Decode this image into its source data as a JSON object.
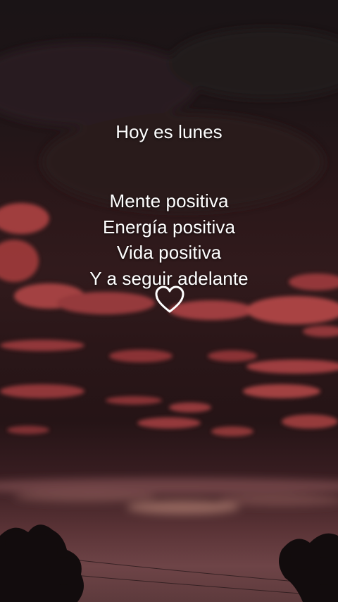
{
  "caption": {
    "title": "Hoy es lunes",
    "lines": [
      "Mente positiva",
      "Energía positiva",
      "Vida positiva",
      "Y a seguir adelante"
    ],
    "heart_icon": "heart-outline-icon"
  },
  "colors": {
    "text": "#ffffff",
    "cloud_red": "#c84a4a",
    "sky_dark": "#1a1416"
  }
}
